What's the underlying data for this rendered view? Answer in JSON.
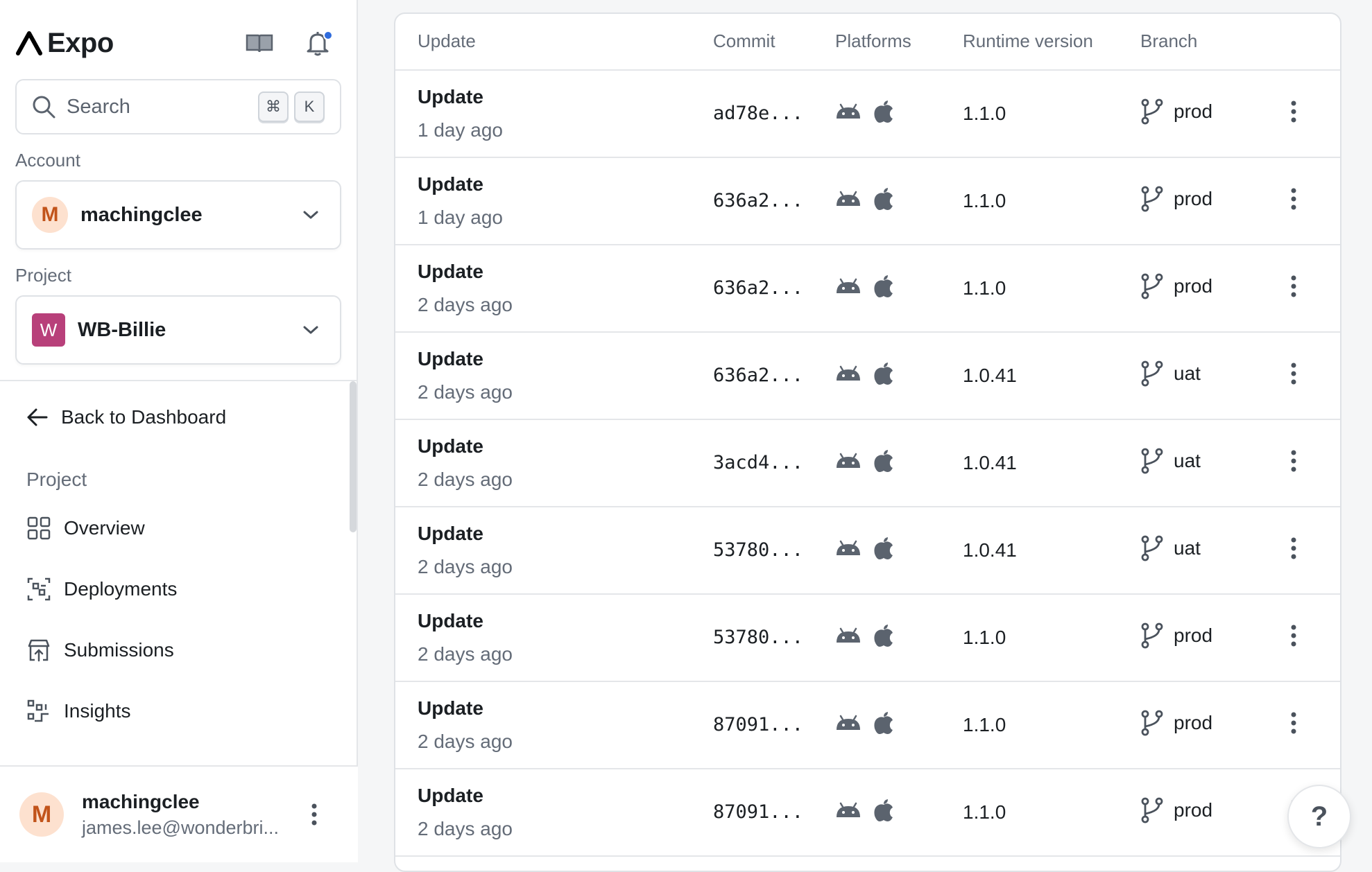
{
  "sidebar": {
    "brand": "Expo",
    "search": {
      "placeholder": "Search",
      "kbd_mod": "⌘",
      "kbd_key": "K"
    },
    "account": {
      "label": "Account",
      "initial": "M",
      "name": "machingclee"
    },
    "project": {
      "label": "Project",
      "initial": "W",
      "name": "WB-Billie",
      "color": "#b8407a"
    },
    "back_label": "Back to Dashboard",
    "nav_section": "Project",
    "nav": [
      {
        "label": "Overview",
        "icon": "grid-icon"
      },
      {
        "label": "Deployments",
        "icon": "deployments-icon"
      },
      {
        "label": "Submissions",
        "icon": "store-upload-icon"
      },
      {
        "label": "Insights",
        "icon": "insights-icon"
      }
    ],
    "user": {
      "initial": "M",
      "name": "machingclee",
      "email": "james.lee@wonderbri..."
    },
    "notification_color": "#2f6bdc"
  },
  "table": {
    "headers": [
      "Update",
      "Commit",
      "Platforms",
      "Runtime version",
      "Branch"
    ],
    "rows": [
      {
        "title": "Update",
        "time": "1 day ago",
        "commit": "ad78e...",
        "runtime": "1.1.0",
        "branch": "prod"
      },
      {
        "title": "Update",
        "time": "1 day ago",
        "commit": "636a2...",
        "runtime": "1.1.0",
        "branch": "prod"
      },
      {
        "title": "Update",
        "time": "2 days ago",
        "commit": "636a2...",
        "runtime": "1.1.0",
        "branch": "prod"
      },
      {
        "title": "Update",
        "time": "2 days ago",
        "commit": "636a2...",
        "runtime": "1.0.41",
        "branch": "uat"
      },
      {
        "title": "Update",
        "time": "2 days ago",
        "commit": "3acd4...",
        "runtime": "1.0.41",
        "branch": "uat"
      },
      {
        "title": "Update",
        "time": "2 days ago",
        "commit": "53780...",
        "runtime": "1.0.41",
        "branch": "uat"
      },
      {
        "title": "Update",
        "time": "2 days ago",
        "commit": "53780...",
        "runtime": "1.1.0",
        "branch": "prod"
      },
      {
        "title": "Update",
        "time": "2 days ago",
        "commit": "87091...",
        "runtime": "1.1.0",
        "branch": "prod"
      },
      {
        "title": "Update",
        "time": "2 days ago",
        "commit": "87091...",
        "runtime": "1.1.0",
        "branch": "prod"
      }
    ]
  },
  "help_label": "?"
}
